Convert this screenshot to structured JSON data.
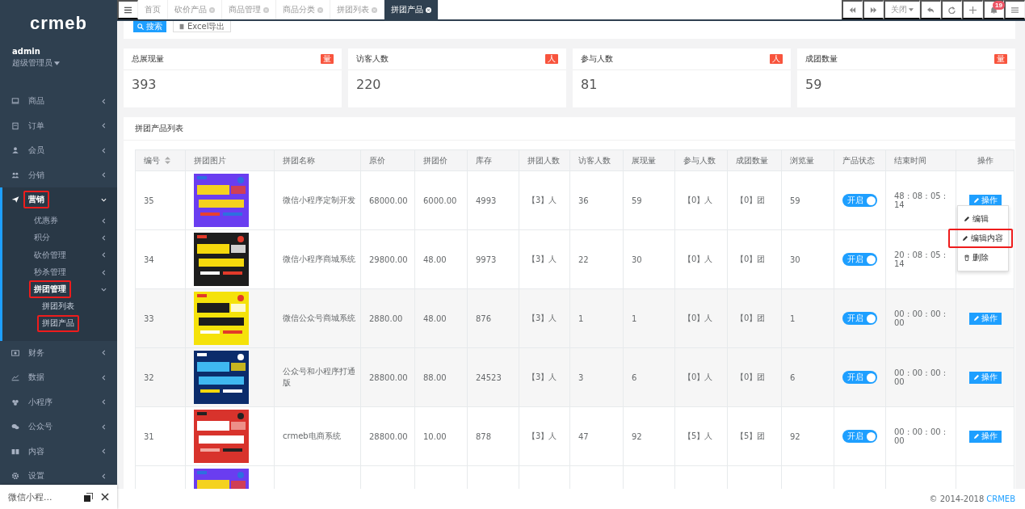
{
  "sidebar": {
    "logo": "crmeb",
    "user": {
      "name": "admin",
      "role": "超级管理员"
    },
    "items": [
      {
        "label": "商品",
        "expanded": false,
        "highlighted": false
      },
      {
        "label": "订单",
        "expanded": false,
        "highlighted": false
      },
      {
        "label": "会员",
        "expanded": false,
        "highlighted": false
      },
      {
        "label": "分销",
        "expanded": false,
        "highlighted": false
      },
      {
        "label": "营销",
        "expanded": true,
        "highlighted": true,
        "children": [
          {
            "label": "优惠券",
            "expanded": false,
            "highlighted": false
          },
          {
            "label": "积分",
            "expanded": false,
            "highlighted": false
          },
          {
            "label": "砍价管理",
            "expanded": false,
            "highlighted": false
          },
          {
            "label": "秒杀管理",
            "expanded": false,
            "highlighted": false
          },
          {
            "label": "拼团管理",
            "expanded": true,
            "highlighted": true,
            "children": [
              {
                "label": "拼团列表",
                "highlighted": false
              },
              {
                "label": "拼团产品",
                "highlighted": true
              }
            ]
          }
        ]
      },
      {
        "label": "财务",
        "expanded": false,
        "highlighted": false
      },
      {
        "label": "数据",
        "expanded": false,
        "highlighted": false
      },
      {
        "label": "小程序",
        "expanded": false,
        "highlighted": false
      },
      {
        "label": "公众号",
        "expanded": false,
        "highlighted": false
      },
      {
        "label": "内容",
        "expanded": false,
        "highlighted": false
      },
      {
        "label": "设置",
        "expanded": false,
        "highlighted": false
      }
    ]
  },
  "popup": {
    "title": "微信小程..."
  },
  "tabs": [
    {
      "label": "首页",
      "selected": false,
      "closable": false
    },
    {
      "label": "砍价产品",
      "selected": false,
      "closable": true
    },
    {
      "label": "商品管理",
      "selected": false,
      "closable": true
    },
    {
      "label": "商品分类",
      "selected": false,
      "closable": true
    },
    {
      "label": "拼团列表",
      "selected": false,
      "closable": true
    },
    {
      "label": "拼团产品",
      "selected": true,
      "closable": true
    }
  ],
  "toolbar": {
    "close_label": "关闭",
    "notification_count": "19"
  },
  "filters": {
    "search_button": "搜索",
    "export_button": "Excel导出"
  },
  "stats": [
    {
      "title": "总展现量",
      "badge": "量",
      "value": "393"
    },
    {
      "title": "访客人数",
      "badge": "人",
      "value": "220"
    },
    {
      "title": "参与人数",
      "badge": "人",
      "value": "81"
    },
    {
      "title": "成团数量",
      "badge": "量",
      "value": "59"
    }
  ],
  "table": {
    "title": "拼团产品列表",
    "columns": [
      {
        "label": "编号",
        "sortable": true
      },
      {
        "label": "拼团图片",
        "sortable": false
      },
      {
        "label": "拼团名称",
        "sortable": false
      },
      {
        "label": "原价",
        "sortable": false
      },
      {
        "label": "拼团价",
        "sortable": false
      },
      {
        "label": "库存",
        "sortable": false
      },
      {
        "label": "拼团人数",
        "sortable": false
      },
      {
        "label": "访客人数",
        "sortable": false
      },
      {
        "label": "展现量",
        "sortable": false
      },
      {
        "label": "参与人数",
        "sortable": false
      },
      {
        "label": "成团数量",
        "sortable": false
      },
      {
        "label": "浏览量",
        "sortable": false
      },
      {
        "label": "产品状态",
        "sortable": false
      },
      {
        "label": "结束时间",
        "sortable": false
      },
      {
        "label": "操作",
        "sortable": false
      }
    ],
    "rows": [
      {
        "shaded": false,
        "cells": [
          "35",
          "微信小程序定制开发",
          "68000.00",
          "6000.00",
          "4993",
          "【3】人",
          "36",
          "59",
          "【0】人",
          "【0】团",
          "59"
        ],
        "status": {
          "label": "开启",
          "on": true
        },
        "end_time": "48 : 08 : 05 : 14",
        "action": "操作"
      },
      {
        "shaded": false,
        "cells": [
          "34",
          "微信小程序商城系统",
          "29800.00",
          "48.00",
          "9973",
          "【3】人",
          "22",
          "30",
          "【0】人",
          "【0】团",
          "30"
        ],
        "status": {
          "label": "开启",
          "on": true
        },
        "end_time": "20 : 08 : 05 : 14"
      },
      {
        "shaded": true,
        "cells": [
          "33",
          "微信公众号商城系统",
          "2880.00",
          "48.00",
          "876",
          "【3】人",
          "1",
          "1",
          "【0】人",
          "【0】团",
          "1"
        ],
        "status": {
          "label": "开启",
          "on": true
        },
        "end_time": "00 : 00 : 00 : 00",
        "action": "操作"
      },
      {
        "shaded": true,
        "cells": [
          "32",
          "公众号和小程序打通版",
          "28800.00",
          "88.00",
          "24523",
          "【3】人",
          "3",
          "6",
          "【0】人",
          "【0】团",
          "6"
        ],
        "status": {
          "label": "开启",
          "on": true
        },
        "end_time": "00 : 00 : 00 : 00",
        "action": "操作"
      },
      {
        "shaded": false,
        "cells": [
          "31",
          "crmeb电商系统",
          "28800.00",
          "10.00",
          "878",
          "【3】人",
          "47",
          "92",
          "【5】人",
          "【5】团",
          "92"
        ],
        "status": {
          "label": "开启",
          "on": true
        },
        "end_time": "00 : 00 : 00 : 00",
        "action": "操作"
      },
      {
        "shaded": false,
        "partial": true
      }
    ],
    "menu": [
      {
        "label": "编辑",
        "highlighted": false
      },
      {
        "label": "编辑内容",
        "highlighted": true
      },
      {
        "label": "删除",
        "highlighted": false
      }
    ]
  },
  "footer": {
    "copyright": "© 2014-2018",
    "link": "CRMEB"
  }
}
